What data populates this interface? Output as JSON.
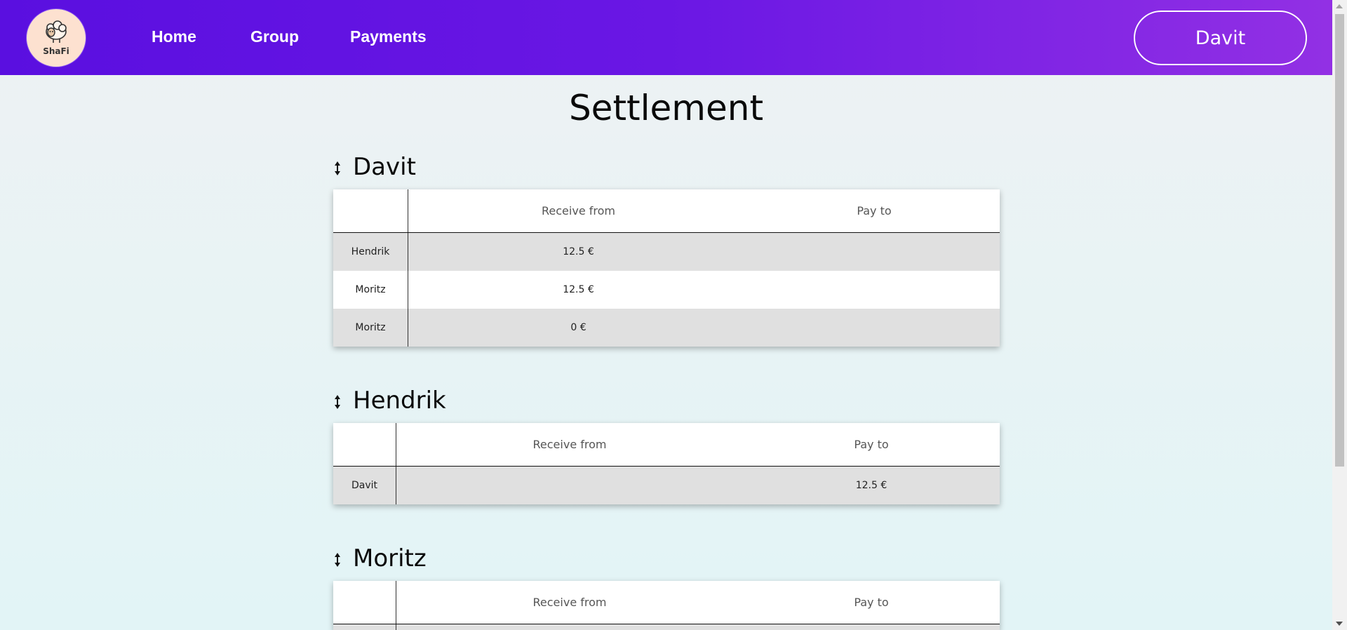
{
  "nav": {
    "logo_text": "ShaFi",
    "links": [
      "Home",
      "Group",
      "Payments"
    ],
    "user": "Davit"
  },
  "page_title": "Settlement",
  "sections": [
    {
      "name": "Davit",
      "headers": {
        "receive": "Receive from",
        "pay": "Pay to"
      },
      "rows": [
        {
          "person": "Hendrik",
          "receive": "12.5 €",
          "pay": ""
        },
        {
          "person": "Moritz",
          "receive": "12.5 €",
          "pay": ""
        },
        {
          "person": "Moritz",
          "receive": "0 €",
          "pay": ""
        }
      ]
    },
    {
      "name": "Hendrik",
      "headers": {
        "receive": "Receive from",
        "pay": "Pay to"
      },
      "rows": [
        {
          "person": "Davit",
          "receive": "",
          "pay": "12.5 €"
        }
      ]
    },
    {
      "name": "Moritz",
      "headers": {
        "receive": "Receive from",
        "pay": "Pay to"
      },
      "rows": []
    }
  ],
  "colors": {
    "nav_gradient_start": "#5a0fe0",
    "nav_gradient_end": "#9230e4",
    "row_alt": "#e0e0e0"
  }
}
